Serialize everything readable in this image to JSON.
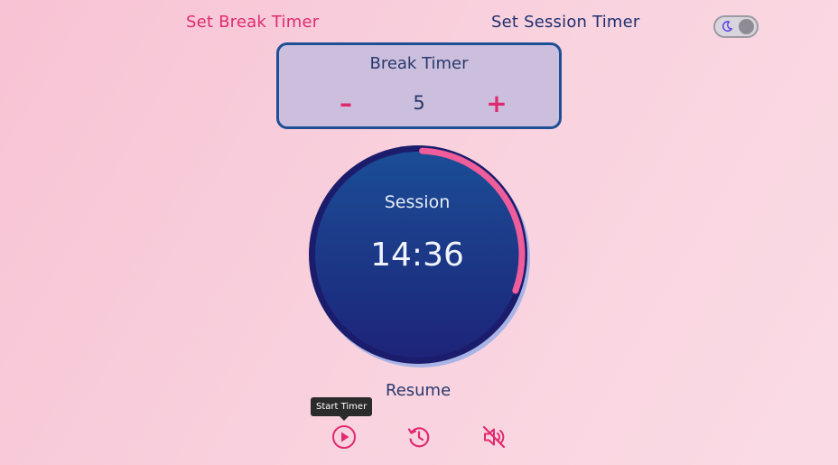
{
  "nav": {
    "break_tab": "Set Break Timer",
    "session_tab": "Set Session Timer"
  },
  "theme_toggle": {
    "icon": "moon-icon",
    "state": "off"
  },
  "break_panel": {
    "title": "Break Timer",
    "decrement_label": "–",
    "value": "5",
    "increment_label": "+"
  },
  "timer": {
    "mode": "Session",
    "time": "14:36",
    "progress": 0.3
  },
  "status": "Resume",
  "tooltip": "Start Timer",
  "controls": {
    "play_icon": "play-icon",
    "reset_icon": "history-icon",
    "mute_icon": "volume-muted-icon"
  },
  "colors": {
    "accent_pink": "#e02a70",
    "navy": "#1f2f6e",
    "progress_ring": "#ef5d9a",
    "clock_face": "#173a8a"
  }
}
